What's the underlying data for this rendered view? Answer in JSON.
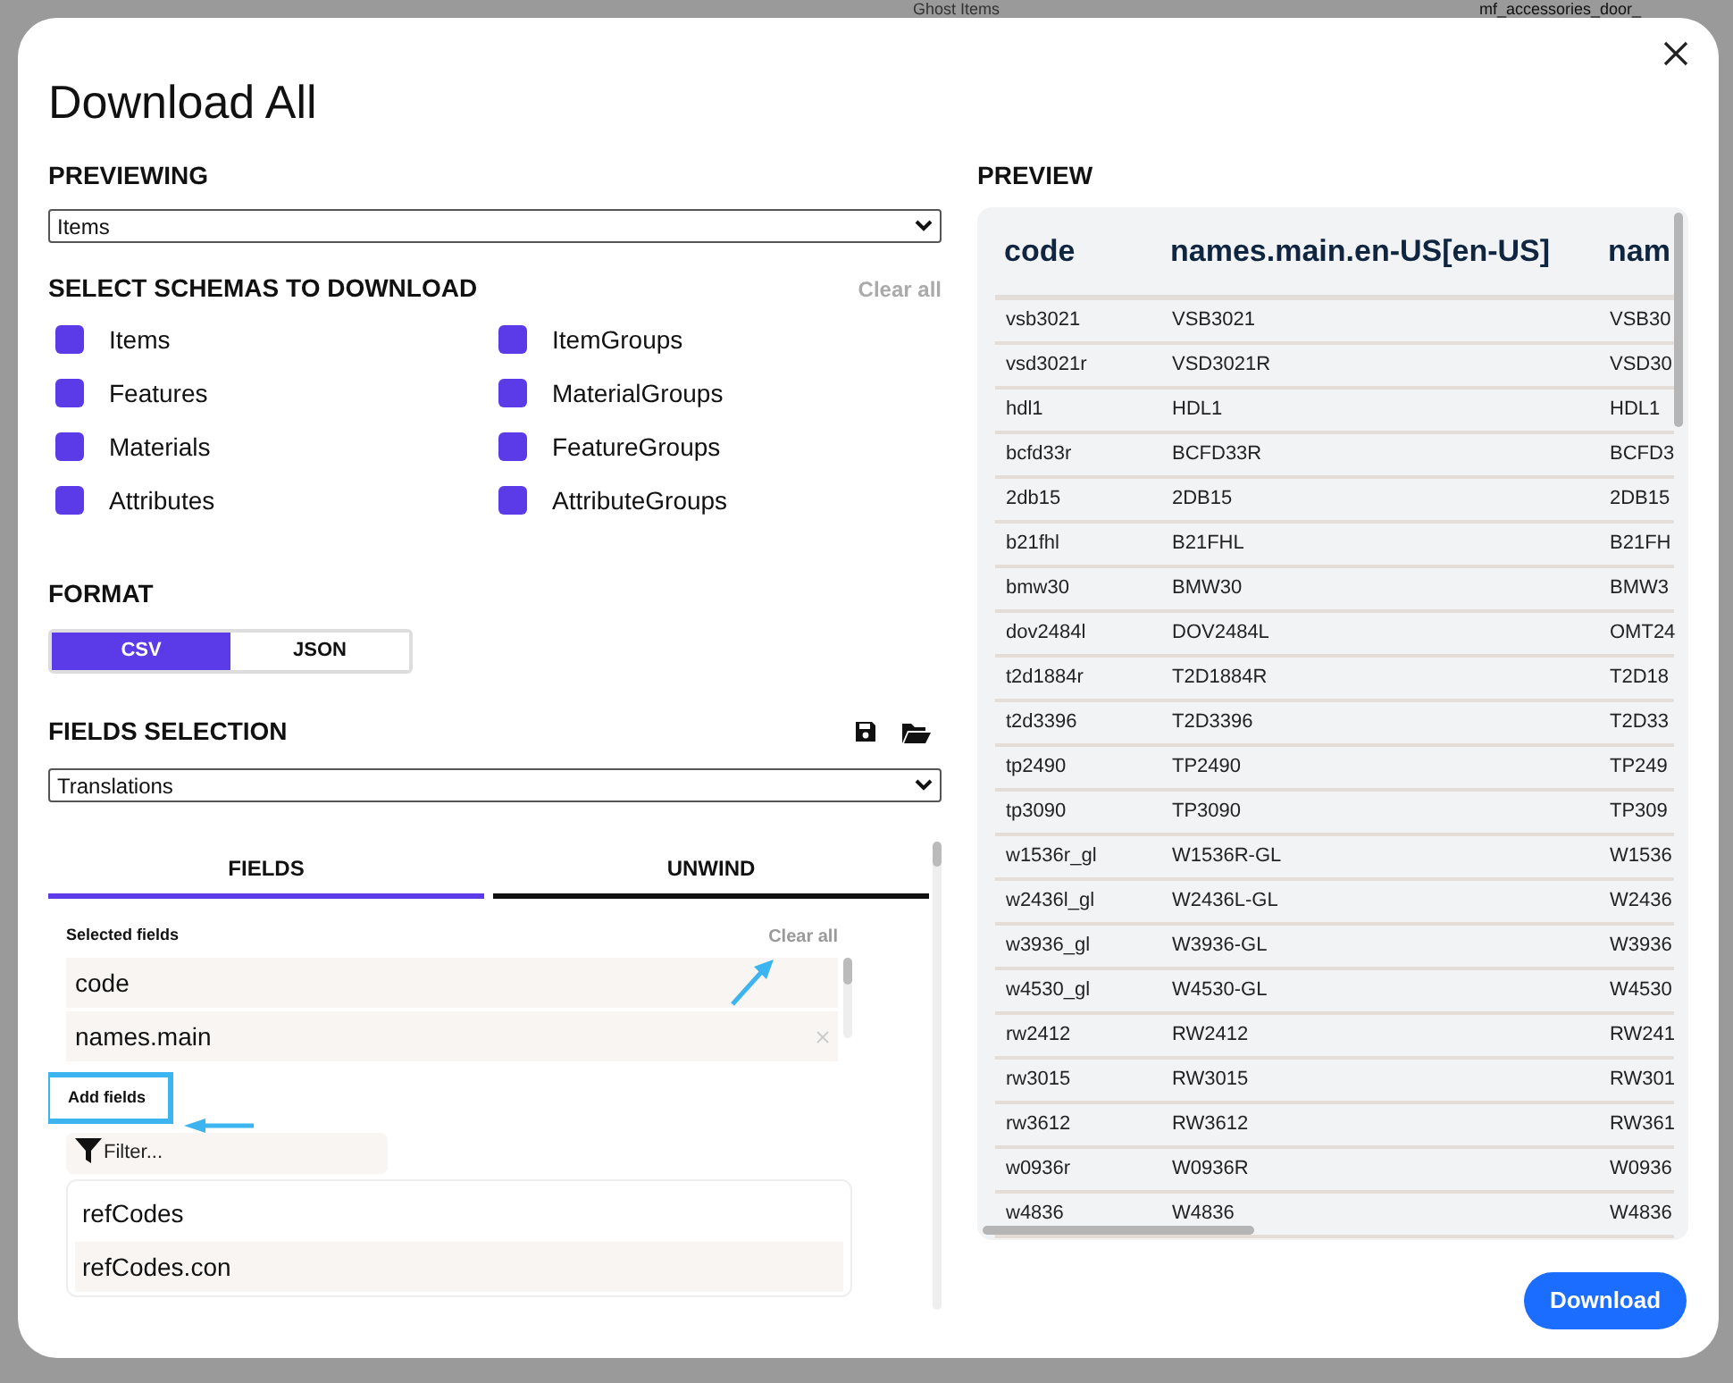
{
  "background": {
    "texts": [
      "Ghost Items",
      "mf_accessories_door_"
    ]
  },
  "dialog": {
    "title": "Download All"
  },
  "previewing": {
    "heading": "PREVIEWING",
    "value": "Items"
  },
  "schemas": {
    "heading": "SELECT SCHEMAS TO DOWNLOAD",
    "clear": "Clear all",
    "items": [
      {
        "label": "Items",
        "checked": true
      },
      {
        "label": "ItemGroups",
        "checked": true
      },
      {
        "label": "Features",
        "checked": true
      },
      {
        "label": "MaterialGroups",
        "checked": true
      },
      {
        "label": "Materials",
        "checked": true
      },
      {
        "label": "FeatureGroups",
        "checked": true
      },
      {
        "label": "Attributes",
        "checked": true
      },
      {
        "label": "AttributeGroups",
        "checked": true
      }
    ]
  },
  "format": {
    "heading": "FORMAT",
    "options": [
      {
        "label": "CSV",
        "selected": true
      },
      {
        "label": "JSON",
        "selected": false
      }
    ]
  },
  "fields_selection": {
    "heading": "FIELDS SELECTION",
    "value": "Translations",
    "tabs": [
      {
        "label": "FIELDS",
        "selected": true
      },
      {
        "label": "UNWIND",
        "selected": false
      }
    ],
    "selected_heading": "Selected fields",
    "clear": "Clear all",
    "selected_fields": [
      "code",
      "names.main"
    ],
    "add_heading": "Add fields",
    "filter_placeholder": "Filter...",
    "available_fields": [
      "refCodes",
      "refCodes.con"
    ]
  },
  "preview": {
    "heading": "PREVIEW",
    "columns": [
      "code",
      "names.main.en-US[en-US]",
      "nam"
    ],
    "rows": [
      [
        "vsb3021",
        "VSB3021",
        "VSB30"
      ],
      [
        "vsd3021r",
        "VSD3021R",
        "VSD30"
      ],
      [
        "hdl1",
        "HDL1",
        "HDL1"
      ],
      [
        "bcfd33r",
        "BCFD33R",
        "BCFD3"
      ],
      [
        "2db15",
        "2DB15",
        "2DB15"
      ],
      [
        "b21fhl",
        "B21FHL",
        "B21FH"
      ],
      [
        "bmw30",
        "BMW30",
        "BMW3"
      ],
      [
        "dov2484l",
        "DOV2484L",
        "OMT24"
      ],
      [
        "t2d1884r",
        "T2D1884R",
        "T2D18"
      ],
      [
        "t2d3396",
        "T2D3396",
        "T2D33"
      ],
      [
        "tp2490",
        "TP2490",
        "TP249"
      ],
      [
        "tp3090",
        "TP3090",
        "TP309"
      ],
      [
        "w1536r_gl",
        "W1536R-GL",
        "W1536"
      ],
      [
        "w2436l_gl",
        "W2436L-GL",
        "W2436"
      ],
      [
        "w3936_gl",
        "W3936-GL",
        "W3936"
      ],
      [
        "w4530_gl",
        "W4530-GL",
        "W4530"
      ],
      [
        "rw2412",
        "RW2412",
        "RW241"
      ],
      [
        "rw3015",
        "RW3015",
        "RW301"
      ],
      [
        "rw3612",
        "RW3612",
        "RW361"
      ],
      [
        "w0936r",
        "W0936R",
        "W0936"
      ],
      [
        "w4836",
        "W4836",
        "W4836"
      ]
    ]
  },
  "download_button": "Download"
}
